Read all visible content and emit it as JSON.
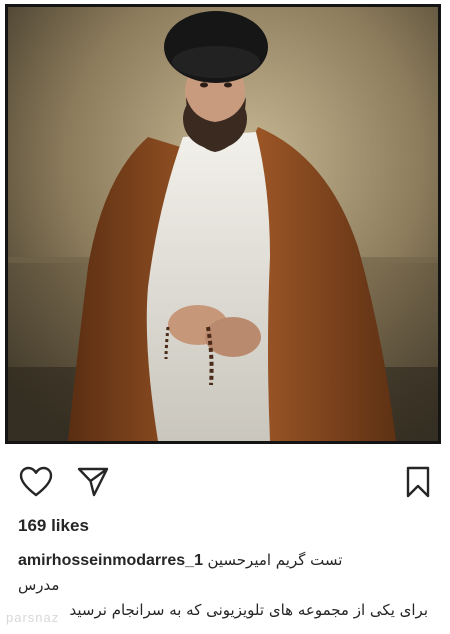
{
  "photo": {
    "alt": "Man wearing black turban, white robe and brown cloak holding prayer beads"
  },
  "actions": {
    "like_icon": "heart-outline-icon",
    "share_icon": "paper-plane-icon",
    "save_icon": "bookmark-outline-icon"
  },
  "likes": "169 likes",
  "caption": {
    "username": "amirhosseinmodarres_1",
    "line1": "تست گریم امیرحسین",
    "line2": "مدرس",
    "line3": "برای یکی از مجموعه های تلویزیونی که به سرانجام نرسید"
  },
  "watermark": "parsnaz"
}
